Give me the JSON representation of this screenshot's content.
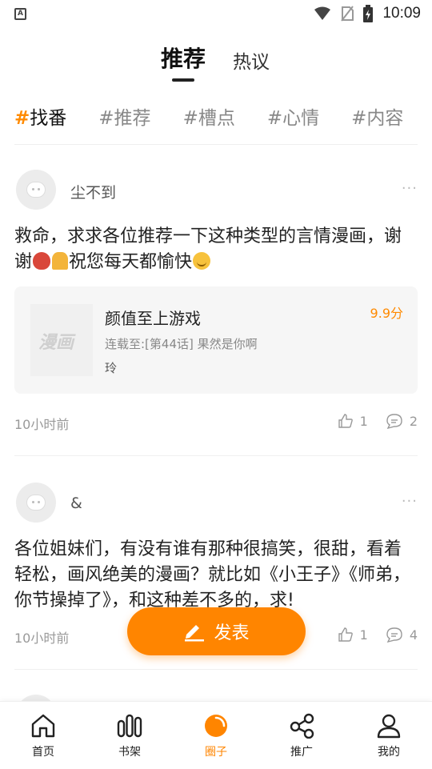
{
  "status_bar": {
    "time": "10:09",
    "left_glyph": "A"
  },
  "top_tabs": {
    "active": "推荐",
    "other": "热议"
  },
  "tags": [
    {
      "hash": "#",
      "label": "找番"
    },
    {
      "label": "#推荐"
    },
    {
      "label": "#槽点"
    },
    {
      "label": "#心情"
    },
    {
      "label": "#内容"
    }
  ],
  "posts": [
    {
      "username": "尘不到",
      "more": "···",
      "text_before_emojis": "救命，求求各位推荐一下这种类型的言情漫画，谢谢",
      "text_after_emojis": "祝您每天都愉快",
      "emojis": [
        "rose-emoji",
        "pray-emoji",
        "smile-emoji"
      ],
      "card": {
        "cover_watermark": "漫画",
        "title": "颜值至上游戏",
        "score": "9.9分",
        "update": "连载至:[第44话] 果然是你啊",
        "author": "玲"
      },
      "time": "10小时前",
      "likes": "1",
      "comments": "2"
    },
    {
      "username": "&",
      "more": "···",
      "text": "各位姐妹们，有没有谁有那种很搞笑，很甜，看着轻松，画风绝美的漫画？就比如《小王子》《师弟，你节操掉了》，和这种差不多的，求!",
      "time": "10小时前",
      "likes": "1",
      "comments": "4"
    }
  ],
  "fab": {
    "label": "发表"
  },
  "bottom_nav": [
    {
      "label": "首页",
      "icon": "home-icon"
    },
    {
      "label": "书架",
      "icon": "bookshelf-icon"
    },
    {
      "label": "圈子",
      "icon": "circle-icon",
      "active": true
    },
    {
      "label": "推广",
      "icon": "share-icon"
    },
    {
      "label": "我的",
      "icon": "profile-icon"
    }
  ],
  "colors": {
    "accent": "#ff8500",
    "score": "#ff8a00"
  }
}
